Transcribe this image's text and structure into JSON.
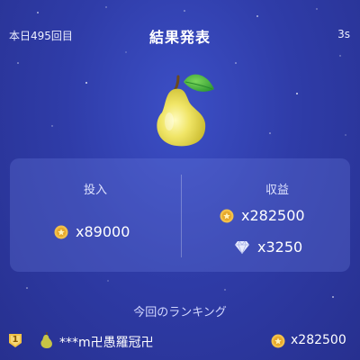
{
  "header": {
    "round_label": "本日495回目",
    "title": "結果発表",
    "timer": "3s"
  },
  "result_icon": "pear-icon",
  "panel": {
    "invest_label": "投入",
    "invest_amount": "x89000",
    "profit_label": "収益",
    "profit_coins": "x282500",
    "profit_gems": "x3250"
  },
  "ranking": {
    "title": "今回のランキング",
    "rows": [
      {
        "rank": "1",
        "fruit_icon": "pear-icon",
        "name": "***m卍愚羅冠卍",
        "payout": "x282500"
      }
    ]
  },
  "colors": {
    "background": "#2f3ca8",
    "coin": "#f3c14a",
    "pear": "#e6dc54",
    "leaf": "#3fae3b"
  }
}
